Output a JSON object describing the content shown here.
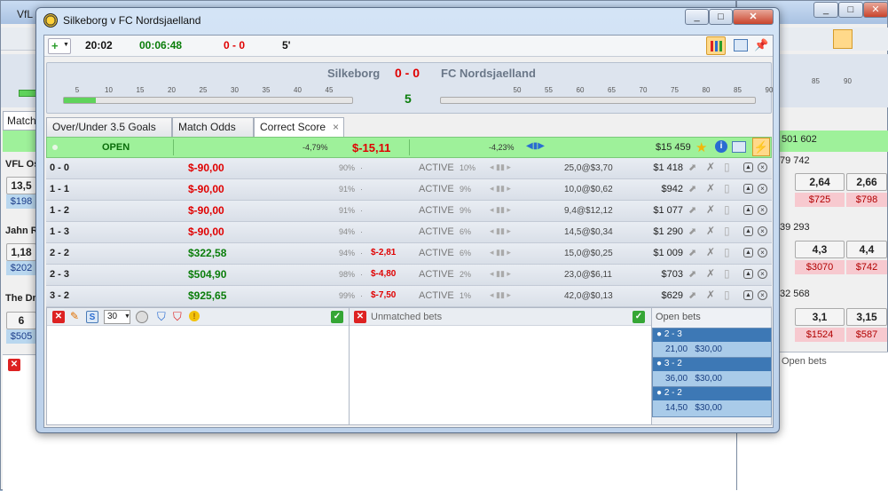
{
  "bg_left": {
    "title": "VfL",
    "tab": "Match",
    "team1": "VFL Os",
    "team1_val": "13,5",
    "team1_sub": "$198",
    "team2": "Jahn R",
    "team2_val": "1,18",
    "team2_sub": "$202",
    "team3": "The Dr",
    "team3_val": "6",
    "team3_sub": "$505"
  },
  "bg_right": {
    "ticks": [
      "85",
      "90"
    ],
    "amount": "501 602",
    "rows": [
      {
        "label": "79 742",
        "v1": "2,64",
        "v2": "2,66",
        "s1": "$725",
        "s2": "$798"
      },
      {
        "label": "39 293",
        "v1": "4,3",
        "v2": "4,4",
        "s1": "$3070",
        "s2": "$742"
      },
      {
        "label": "32 568",
        "v1": "3,1",
        "v2": "3,15",
        "s1": "$1524",
        "s2": "$587"
      }
    ],
    "open_bets": "Open bets"
  },
  "window": {
    "title": "Silkeborg v FC Nordsjaelland",
    "minimize": "_",
    "maximize": "□",
    "close": "✕"
  },
  "toolbar": {
    "time": "20:02",
    "elapsed": "00:06:48",
    "score": "0 - 0",
    "minute": "5'"
  },
  "scoreboard": {
    "home": "Silkeborg",
    "score": "0 - 0",
    "away": "FC Nordsjaelland",
    "minute": "5",
    "ticks_first": [
      "5",
      "10",
      "15",
      "20",
      "25",
      "30",
      "35",
      "40",
      "45"
    ],
    "ticks_second": [
      "50",
      "55",
      "60",
      "65",
      "70",
      "75",
      "80",
      "85",
      "90"
    ],
    "progress": 0.11
  },
  "tabs": [
    {
      "label": "Over/Under 3.5 Goals"
    },
    {
      "label": "Match Odds"
    },
    {
      "label": "Correct Score",
      "close": "×"
    }
  ],
  "status": {
    "state": "OPEN",
    "pct1": "-4,79%",
    "pl": "$-15,11",
    "pct2": "-4,23%",
    "matched": "$15 459"
  },
  "rows": [
    {
      "sel": "0 - 0",
      "pl": "$-90,00",
      "pl_color": "red",
      "pct": "90%",
      "ifwin": "",
      "state": "ACTIVE",
      "spct": "10%",
      "odds": "25,0@$3,70",
      "vol": "$1 418"
    },
    {
      "sel": "1 - 1",
      "pl": "$-90,00",
      "pl_color": "red",
      "pct": "91%",
      "ifwin": "",
      "state": "ACTIVE",
      "spct": "9%",
      "odds": "10,0@$0,62",
      "vol": "$942"
    },
    {
      "sel": "1 - 2",
      "pl": "$-90,00",
      "pl_color": "red",
      "pct": "91%",
      "ifwin": "",
      "state": "ACTIVE",
      "spct": "9%",
      "odds": "9,4@$12,12",
      "vol": "$1 077"
    },
    {
      "sel": "1 - 3",
      "pl": "$-90,00",
      "pl_color": "red",
      "pct": "94%",
      "ifwin": "",
      "state": "ACTIVE",
      "spct": "6%",
      "odds": "14,5@$0,34",
      "vol": "$1 290"
    },
    {
      "sel": "2 - 2",
      "pl": "$322,58",
      "pl_color": "green",
      "pct": "94%",
      "ifwin": "$-2,81",
      "state": "ACTIVE",
      "spct": "6%",
      "odds": "15,0@$0,25",
      "vol": "$1 009"
    },
    {
      "sel": "2 - 3",
      "pl": "$504,90",
      "pl_color": "green",
      "pct": "98%",
      "ifwin": "$-4,80",
      "state": "ACTIVE",
      "spct": "2%",
      "odds": "23,0@$6,11",
      "vol": "$703"
    },
    {
      "sel": "3 - 2",
      "pl": "$925,65",
      "pl_color": "green",
      "pct": "99%",
      "ifwin": "$-7,50",
      "state": "ACTIVE",
      "spct": "1%",
      "odds": "42,0@$0,13",
      "vol": "$629"
    }
  ],
  "bottom": {
    "stake": "30",
    "unmatched": "Unmatched bets",
    "open_bets": "Open bets",
    "bets": [
      {
        "sel": "2 - 3",
        "odds": "21,00",
        "stake": "$30,00"
      },
      {
        "sel": "3 - 2",
        "odds": "36,00",
        "stake": "$30,00"
      },
      {
        "sel": "2 - 2",
        "odds": "14,50",
        "stake": "$30,00"
      }
    ]
  },
  "colors": {
    "red": "#e00000",
    "green": "#0a7d0a",
    "open": "#9ef19a"
  }
}
